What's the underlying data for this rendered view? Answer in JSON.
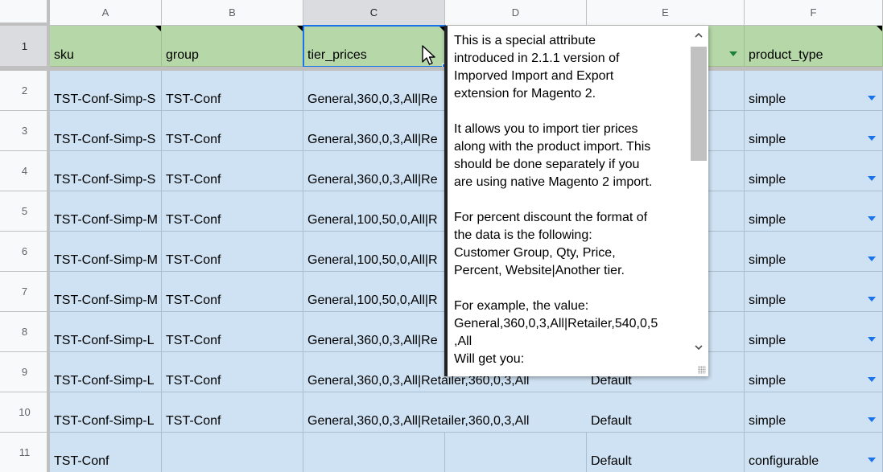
{
  "columns": [
    "A",
    "B",
    "C",
    "D",
    "E",
    "F"
  ],
  "rows": [
    "1",
    "2",
    "3",
    "4",
    "5",
    "6",
    "7",
    "8",
    "9",
    "10",
    "11"
  ],
  "header_row": {
    "sku": "sku",
    "group": "group",
    "tier_prices": "tier_prices",
    "product_type": "product_type"
  },
  "data_rows": [
    {
      "sku": "TST-Conf-Simp-S",
      "group": "TST-Conf",
      "tier_prices": "General,360,0,3,All|Re",
      "attribute_set": "",
      "product_type": "simple"
    },
    {
      "sku": "TST-Conf-Simp-S",
      "group": "TST-Conf",
      "tier_prices": "General,360,0,3,All|Re",
      "attribute_set": "",
      "product_type": "simple"
    },
    {
      "sku": "TST-Conf-Simp-S",
      "group": "TST-Conf",
      "tier_prices": "General,360,0,3,All|Re",
      "attribute_set": "",
      "product_type": "simple"
    },
    {
      "sku": "TST-Conf-Simp-M",
      "group": "TST-Conf",
      "tier_prices": "General,100,50,0,All|R",
      "attribute_set": "",
      "product_type": "simple"
    },
    {
      "sku": "TST-Conf-Simp-M",
      "group": "TST-Conf",
      "tier_prices": "General,100,50,0,All|R",
      "attribute_set": "",
      "product_type": "simple"
    },
    {
      "sku": "TST-Conf-Simp-M",
      "group": "TST-Conf",
      "tier_prices": "General,100,50,0,All|R",
      "attribute_set": "",
      "product_type": "simple"
    },
    {
      "sku": "TST-Conf-Simp-L",
      "group": "TST-Conf",
      "tier_prices": "General,360,0,3,All|Re",
      "attribute_set": "",
      "product_type": "simple"
    },
    {
      "sku": "TST-Conf-Simp-L",
      "group": "TST-Conf",
      "tier_prices": "General,360,0,3,All|Retailer,360,0,3,All",
      "attribute_set": "Default",
      "product_type": "simple"
    },
    {
      "sku": "TST-Conf-Simp-L",
      "group": "TST-Conf",
      "tier_prices": "General,360,0,3,All|Retailer,360,0,3,All",
      "attribute_set": "Default",
      "product_type": "simple"
    },
    {
      "sku": "TST-Conf",
      "group": "",
      "tier_prices": "",
      "attribute_set": "Default",
      "product_type": "configurable"
    }
  ],
  "note": {
    "text": "This is a special attribute\nintroduced in 2.1.1 version of\nImporved Import and Export\nextension for Magento 2.\n\nIt allows you to import tier prices\nalong with the product import. This\nshould be done separately if you\nare using native Magento 2 import.\n\nFor percent discount the format of\nthe data is the following:\nCustomer Group, Qty, Price,\nPercent, Website|Another tier.\n\nFor example, the value:\nGeneral,360,0,3,All|Retailer,540,0,5\n,All\nWill get you:"
  },
  "colors": {
    "header_fill": "#b6d7a8",
    "data_fill": "#cfe2f3",
    "selection": "#1a73e8"
  },
  "icons": {
    "note_corner": "note-indicator-icon",
    "dropdown": "dropdown-arrow-icon",
    "scroll_up": "scroll-up-icon",
    "scroll_down": "scroll-down-icon",
    "resize": "resize-grip-icon",
    "cursor": "mouse-pointer-icon"
  }
}
